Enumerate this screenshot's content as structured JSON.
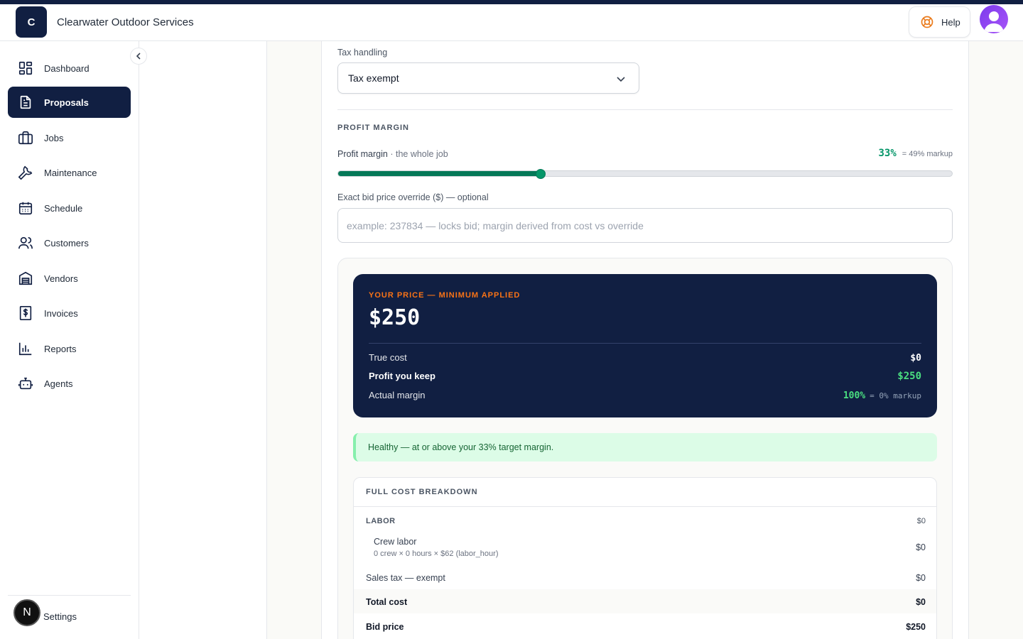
{
  "header": {
    "logo_letter": "C",
    "company_name": "Clearwater Outdoor Services",
    "help_label": "Help"
  },
  "sidebar": {
    "items": [
      {
        "label": "Dashboard",
        "icon": "dashboard-icon"
      },
      {
        "label": "Proposals",
        "icon": "document-icon",
        "active": true
      },
      {
        "label": "Jobs",
        "icon": "briefcase-icon"
      },
      {
        "label": "Maintenance",
        "icon": "wrench-icon"
      },
      {
        "label": "Schedule",
        "icon": "calendar-icon"
      },
      {
        "label": "Customers",
        "icon": "users-icon"
      },
      {
        "label": "Vendors",
        "icon": "warehouse-icon"
      },
      {
        "label": "Invoices",
        "icon": "invoice-icon"
      },
      {
        "label": "Reports",
        "icon": "bar-chart-icon"
      },
      {
        "label": "Agents",
        "icon": "robot-icon"
      }
    ],
    "settings_label": "Settings",
    "badge_letter": "N"
  },
  "tax": {
    "label": "Tax handling",
    "selected": "Tax exempt"
  },
  "margin": {
    "section_title": "PROFIT MARGIN",
    "label": "Profit margin",
    "label_sub": "· the whole job",
    "value": "33%",
    "markup": "= 49% markup",
    "slider_fraction": 0.33
  },
  "override": {
    "label": "Exact bid price override ($) — optional",
    "placeholder": "example: 237834 — locks bid; margin derived from cost vs override",
    "value": ""
  },
  "price_card": {
    "kicker": "YOUR PRICE — MINIMUM APPLIED",
    "price": "$250",
    "true_cost_label": "True cost",
    "true_cost_value": "$0",
    "profit_label": "Profit you keep",
    "profit_value": "$250",
    "margin_label": "Actual margin",
    "margin_value": "100%",
    "margin_markup": "= 0% markup"
  },
  "status": {
    "message": "Healthy — at or above your 33% target margin."
  },
  "breakdown": {
    "title": "FULL COST BREAKDOWN",
    "labor_label": "LABOR",
    "labor_value": "$0",
    "crew_label": "Crew labor",
    "crew_detail": "0 crew × 0 hours × $62 (labor_hour)",
    "crew_value": "$0",
    "tax_label": "Sales tax — exempt",
    "tax_value": "$0",
    "total_label": "Total cost",
    "total_value": "$0",
    "bid_label": "Bid price",
    "bid_value": "$250"
  },
  "colors": {
    "navy": "#111f42",
    "accent_orange": "#f97316",
    "success_green": "#059669",
    "healthy_bg": "#dcfce7"
  }
}
